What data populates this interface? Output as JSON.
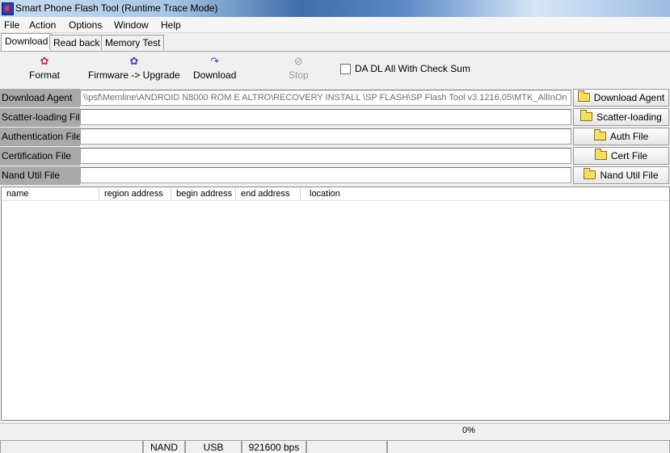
{
  "window": {
    "title": "Smart Phone Flash Tool (Runtime Trace Mode)"
  },
  "menu": [
    "File",
    "Action",
    "Options",
    "Window",
    "Help"
  ],
  "tabs": [
    "Download",
    "Read back",
    "Memory Test"
  ],
  "active_tab": "Download",
  "toolbar": {
    "format": "Format",
    "firmware_upgrade": "Firmware -> Upgrade",
    "download": "Download",
    "stop": "Stop",
    "checksum_label": "DA DL All With Check Sum",
    "checksum_checked": false
  },
  "fields": {
    "download_agent": {
      "label": "Download Agent",
      "value": "\\\\psf\\Memline\\ANDROID N8000 ROM E ALTRO\\RECOVERY INSTALL \\SP FLASH\\SP Flash Tool v3.1216.05\\MTK_AllInOn",
      "button": "Download Agent"
    },
    "scatter": {
      "label": "Scatter-loading File",
      "value": "",
      "button": "Scatter-loading"
    },
    "auth": {
      "label": "Authentication File",
      "value": "",
      "button": "Auth File"
    },
    "cert": {
      "label": "Certification File",
      "value": "",
      "button": "Cert File"
    },
    "nand": {
      "label": "Nand Util File",
      "value": "",
      "button": "Nand Util File"
    }
  },
  "table": {
    "columns": [
      "name",
      "region address",
      "begin address",
      "end address",
      "location"
    ],
    "rows": []
  },
  "progress": {
    "text": "0%",
    "value": 0
  },
  "status": [
    "",
    "NAND",
    "USB",
    "921600 bps",
    "",
    ""
  ],
  "colors": {
    "label_bg": "#a9a9a9",
    "folder": "#f7dd63"
  },
  "icons": {
    "format": "format-icon",
    "firmware": "firmware-icon",
    "download": "download-icon",
    "stop": "stop-icon",
    "folder": "folder-icon"
  }
}
